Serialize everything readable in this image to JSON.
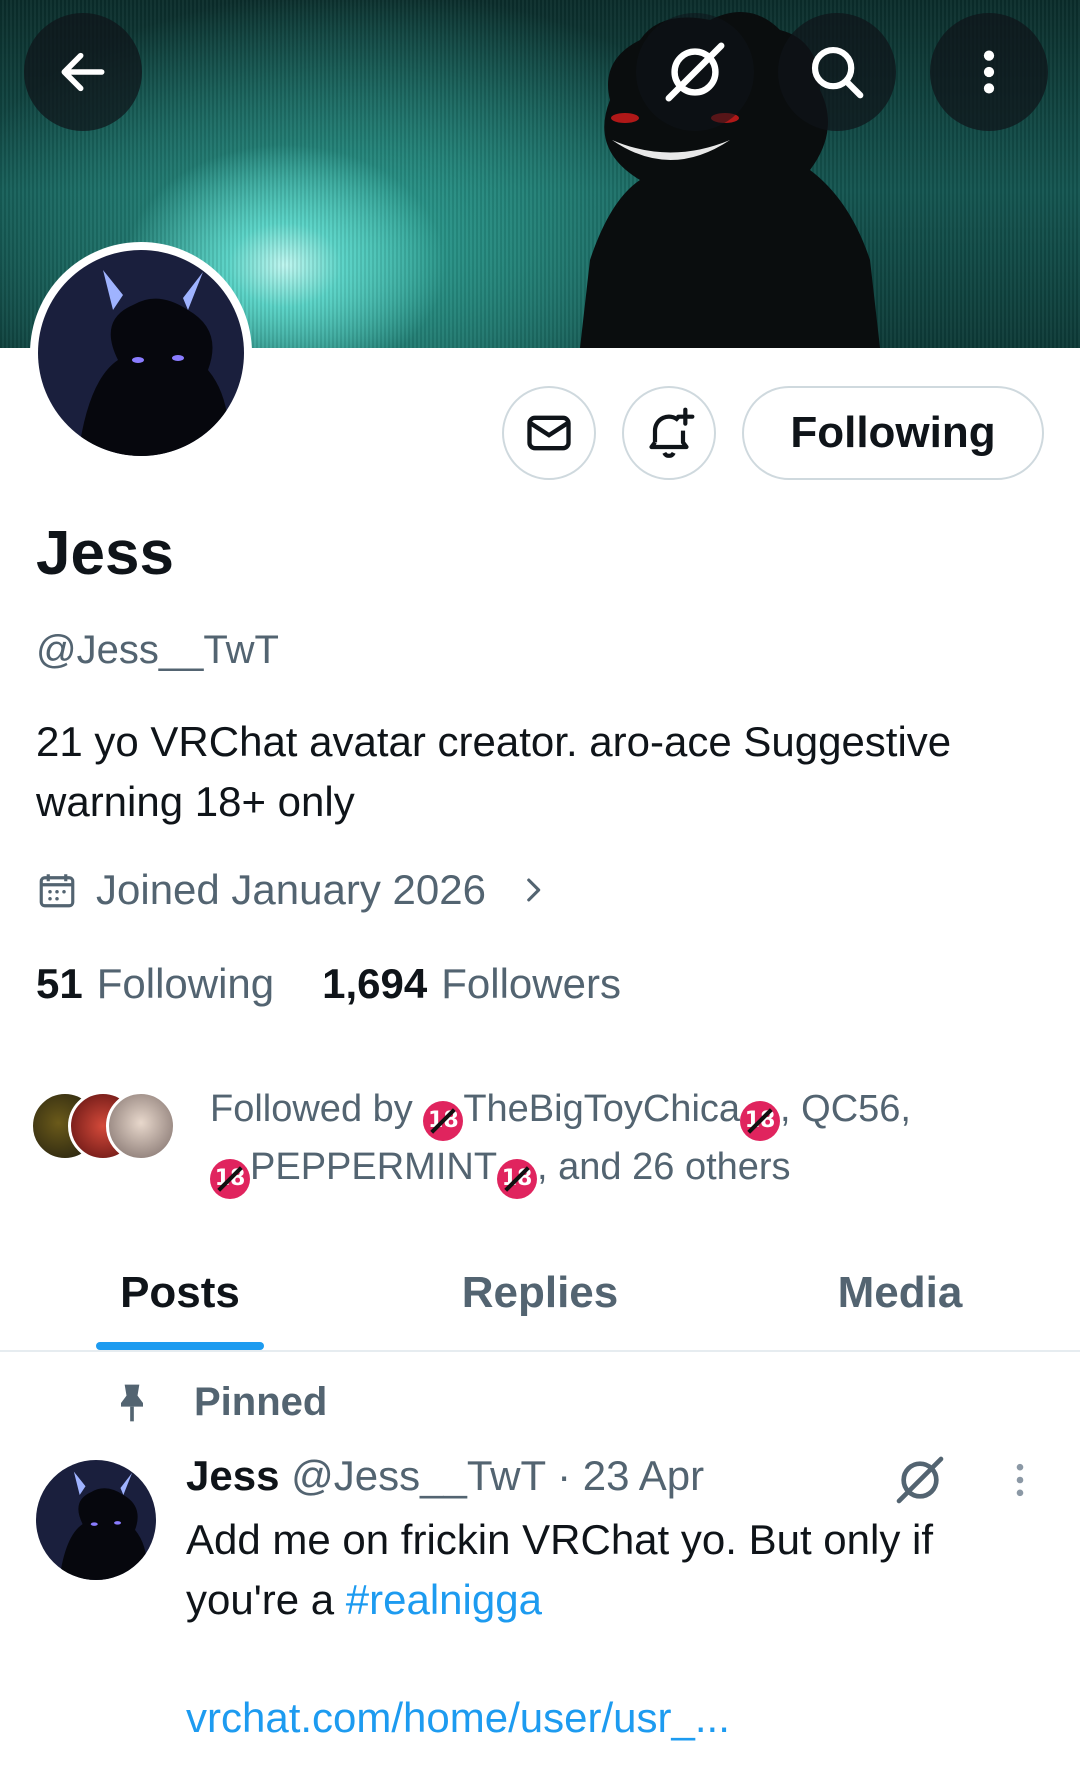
{
  "header": {
    "back_icon": "arrow-left-icon",
    "grok_icon": "grok-icon",
    "search_icon": "search-icon",
    "more_icon": "more-vertical-icon"
  },
  "profile": {
    "display_name": "Jess",
    "handle": "@Jess__TwT",
    "bio": "21 yo VRChat avatar creator. aro-ace Suggestive warning 18+ only",
    "joined": "Joined January 2026",
    "following_count": "51",
    "following_label": "Following",
    "followers_count": "1,694",
    "followers_label": "Followers"
  },
  "actions": {
    "message_icon": "envelope-icon",
    "notify_icon": "bell-plus-icon",
    "following_button": "Following"
  },
  "followed_by": {
    "prefix": "Followed by",
    "user1": "TheBigToyChica",
    "sep1": ", QC56,",
    "user2": "PEPPERMINT",
    "suffix": ", and 26 others",
    "badge": "18"
  },
  "tabs": [
    {
      "label": "Posts",
      "active": true
    },
    {
      "label": "Replies",
      "active": false
    },
    {
      "label": "Media",
      "active": false
    }
  ],
  "pinned_post": {
    "pinned_label": "Pinned",
    "author_name": "Jess",
    "author_handle": "@Jess__TwT",
    "date": "· 23 Apr",
    "text": "Add me on frickin VRChat yo. But only if you're a",
    "hashtag": "#realnigga",
    "link": "vrchat.com/home/user/usr_..."
  },
  "colors": {
    "accent": "#1d9bf0",
    "secondary_text": "#536471",
    "primary_text": "#0f1419",
    "banner_teal": "#145651"
  }
}
